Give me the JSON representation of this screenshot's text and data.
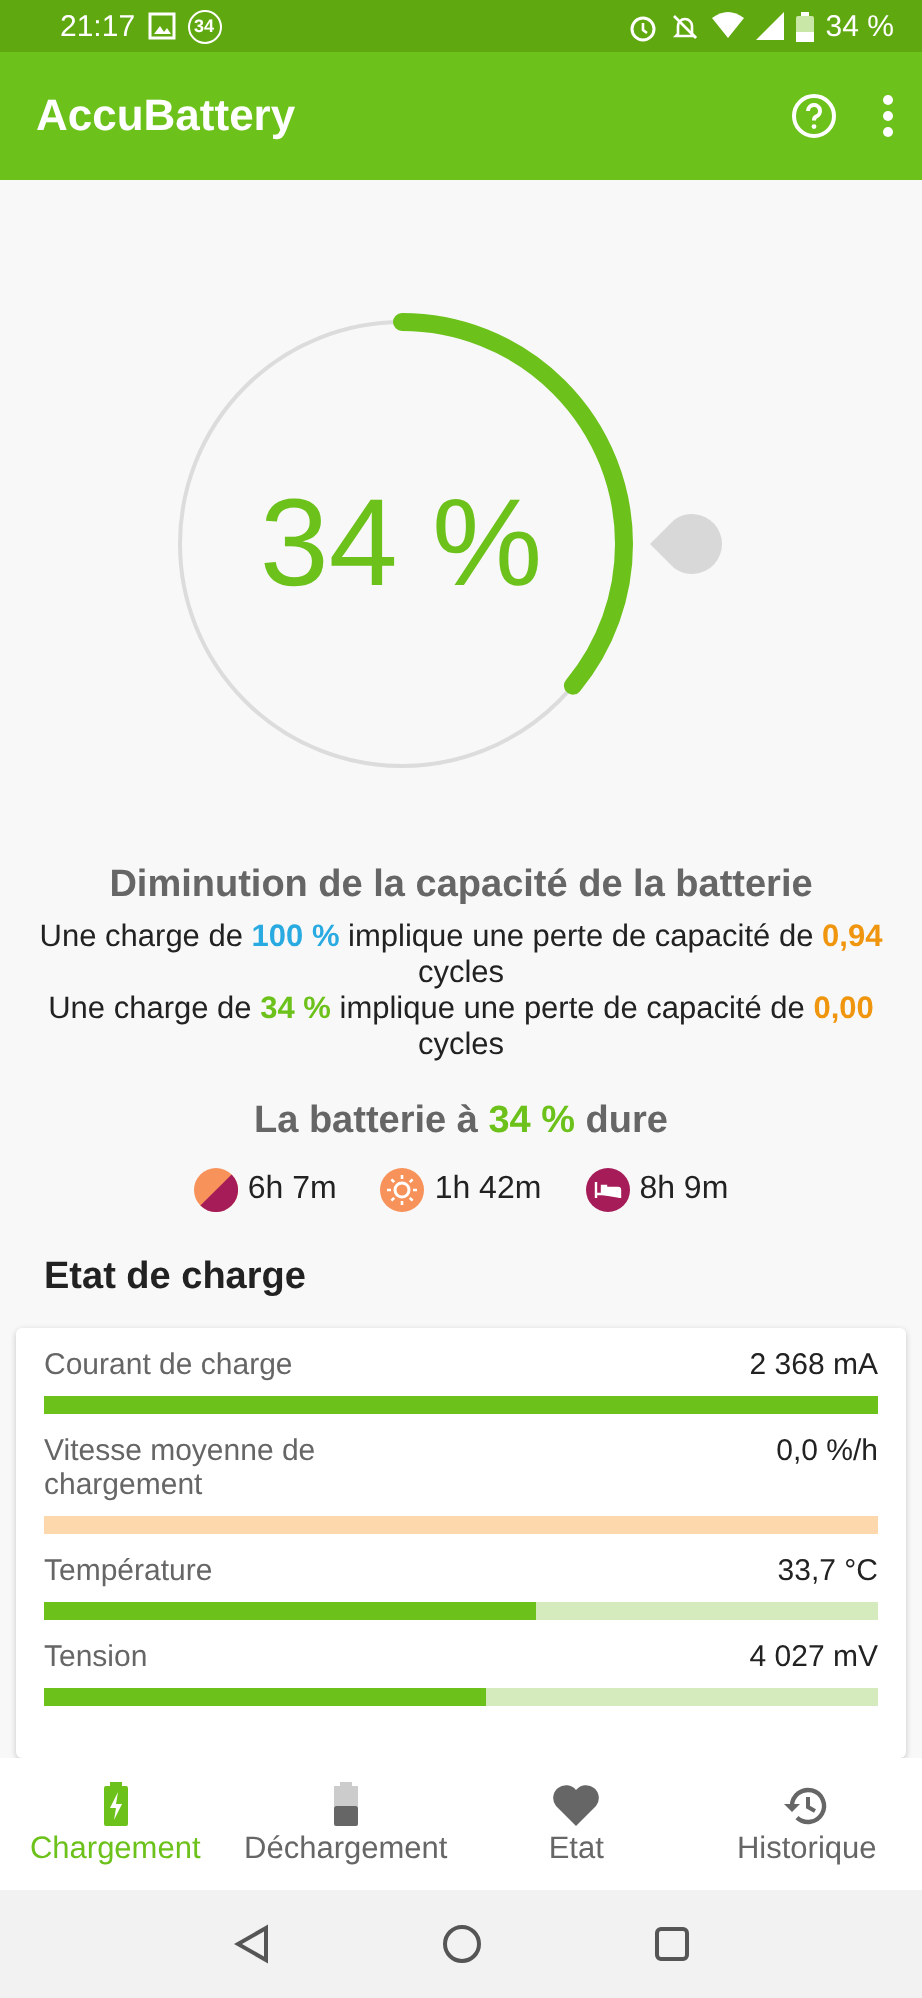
{
  "status_bar": {
    "time": "21:17",
    "badge": "34",
    "battery_text": "34 %"
  },
  "app_bar": {
    "title": "AccuBattery"
  },
  "gauge": {
    "reading": "34 %",
    "level": 0.36
  },
  "capacity": {
    "title": "Diminution de la capacité de la batterie",
    "lines": [
      {
        "before": "Une charge de",
        "value": "100 %",
        "color": "#29abe2",
        "middle": "implique une perte de capacité de",
        "amount": "0,94",
        "after": "cycles"
      },
      {
        "before": "Une charge de",
        "value": "34 %",
        "color": "#6cc11a",
        "middle": "implique une perte de capacité de",
        "amount": "0,00",
        "after": "cycles"
      }
    ]
  },
  "duration": {
    "before": "La batterie à",
    "value": "34 %",
    "after": "dure",
    "items": [
      {
        "kind": "mixed",
        "text": "6h 7m"
      },
      {
        "kind": "screen-on",
        "text": "1h 42m"
      },
      {
        "kind": "sleep",
        "text": "8h 9m"
      }
    ]
  },
  "section_title": "Etat de charge",
  "metrics": [
    {
      "label": "Courant de charge",
      "value": "2 368 mA",
      "level": 1.0,
      "kind": "normal"
    },
    {
      "label": "Vitesse moyenne de chargement",
      "value": "0,0 %/h",
      "level": 0,
      "kind": "warning"
    },
    {
      "label": "Température",
      "value": "33,7 °C",
      "level": 0.59,
      "kind": "normal"
    },
    {
      "label": "Tension",
      "value": "4 027 mV",
      "level": 0.53,
      "kind": "normal"
    }
  ],
  "tabs": [
    {
      "kind": "charging",
      "label": "Chargement",
      "selected": true
    },
    {
      "kind": "discharging",
      "label": "Déchargement",
      "selected": false
    },
    {
      "kind": "health",
      "label": "Etat",
      "selected": false
    },
    {
      "kind": "history",
      "label": "Historique",
      "selected": false
    }
  ]
}
